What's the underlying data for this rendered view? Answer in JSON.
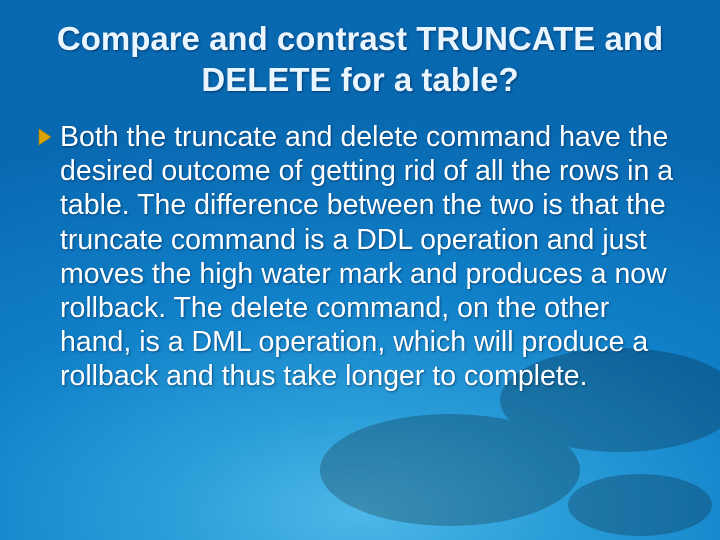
{
  "slide": {
    "title": "Compare and contrast TRUNCATE and DELETE for a table?",
    "bullets": [
      {
        "text": "Both the truncate and delete command have the desired outcome of getting rid of all the rows in a table. The difference between the two is that the truncate command is a DDL operation and just moves the high water mark and produces a now rollback. The delete command, on the other hand, is a DML operation, which will produce a rollback and thus take longer to complete."
      }
    ]
  }
}
